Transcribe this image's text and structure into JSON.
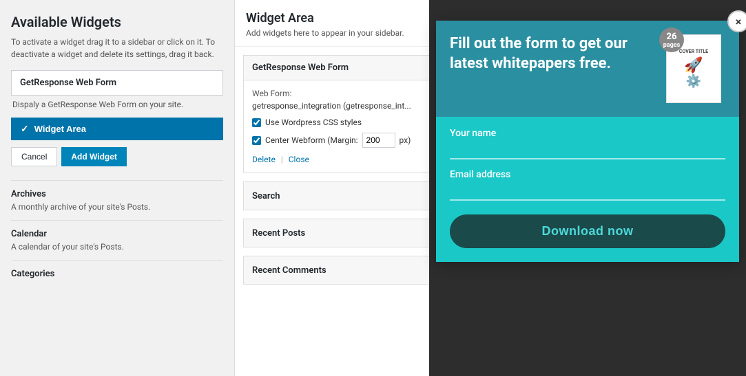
{
  "left": {
    "title": "Available Widgets",
    "description": "To activate a widget drag it to a sidebar or click on it. To deactivate a widget and delete its settings, drag it back.",
    "getresponse_widget_name": "GetResponse Web Form",
    "getresponse_widget_desc": "Dispaly a GetResponse Web Form on your site.",
    "widget_area_btn_label": "Widget Area",
    "cancel_label": "Cancel",
    "add_widget_label": "Add Widget",
    "list": [
      {
        "name": "Archives",
        "desc": "A monthly archive of your site's Posts."
      },
      {
        "name": "Calendar",
        "desc": "A calendar of your site's Posts."
      },
      {
        "name": "Categories",
        "desc": ""
      }
    ]
  },
  "middle": {
    "title": "Widget Area",
    "subtitle": "Add widgets here to appear in your sidebar.",
    "config_title": "GetResponse Web Form",
    "web_form_label": "Web Form:",
    "web_form_value": "getresponse_integration (getresponse_int...",
    "use_wordpress_css": "Use Wordpress CSS styles",
    "center_webform": "Center Webform (Margin:",
    "margin_value": "200",
    "margin_unit": "px)",
    "delete_label": "Delete",
    "close_label": "Close",
    "search_label": "Search",
    "recent_posts_label": "Recent Posts",
    "recent_comments_label": "Recent Comments"
  },
  "popup": {
    "close_icon": "×",
    "headline": "Fill out the form to get our latest whitepapers free.",
    "cover_title": "COVER TITLE",
    "cover_pages": "26",
    "cover_pages_label": "pages",
    "your_name_label": "Your name",
    "email_label": "Email address",
    "download_btn_label": "Download now"
  }
}
